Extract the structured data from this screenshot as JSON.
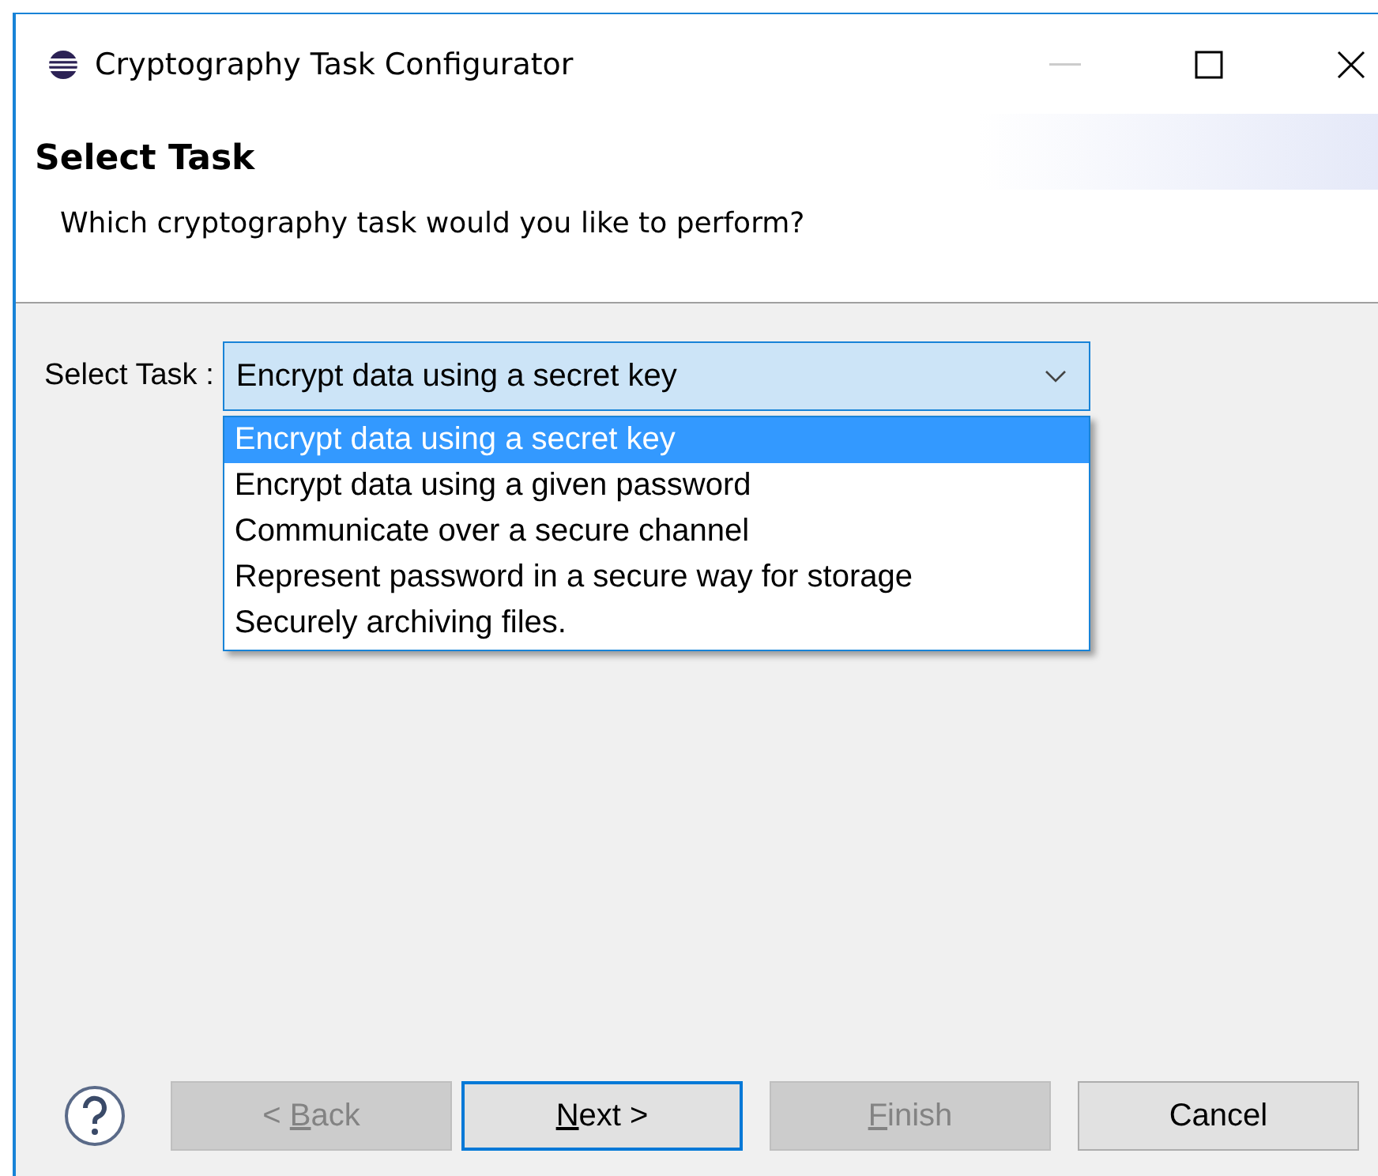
{
  "window": {
    "title": "Cryptography Task Configurator"
  },
  "header": {
    "title": "Select Task",
    "description": "Which cryptography task would you like to perform?"
  },
  "task_field": {
    "label": "Select Task :",
    "value": "Encrypt data using a secret key",
    "expanded": true,
    "options": [
      {
        "label": "Encrypt data using a secret key",
        "selected": true
      },
      {
        "label": "Encrypt data using a given password",
        "selected": false
      },
      {
        "label": "Communicate over a secure channel",
        "selected": false
      },
      {
        "label": "Represent password in a secure way for storage",
        "selected": false
      },
      {
        "label": "Securely archiving files.",
        "selected": false
      }
    ]
  },
  "buttons": [
    {
      "before": "< ",
      "key": "B",
      "after": "ack",
      "disabled": true,
      "focused": false
    },
    {
      "key": "N",
      "after": "ext >",
      "disabled": false,
      "focused": true
    },
    {
      "key": "F",
      "after": "inish",
      "disabled": true,
      "focused": false
    },
    {
      "before": "Cancel",
      "disabled": false,
      "focused": false
    }
  ]
}
